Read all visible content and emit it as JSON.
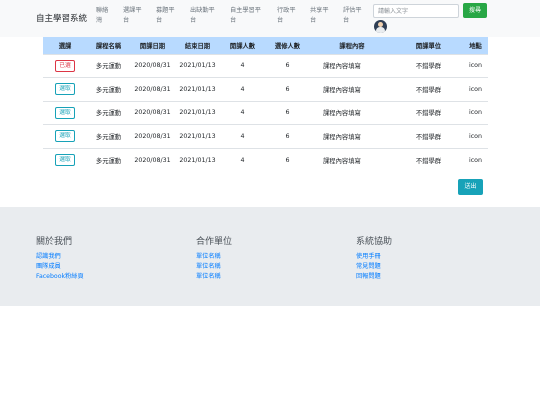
{
  "navbar": {
    "brand": "自主學習系統",
    "items": [
      {
        "line1": "聯絡",
        "line2": "灣"
      },
      {
        "line1": "選課平",
        "line2": "台"
      },
      {
        "line1": "募題平",
        "line2": "台"
      },
      {
        "line1": "出缺勤平",
        "line2": "台"
      },
      {
        "line1": "自主學習平",
        "line2": "台"
      },
      {
        "line1": "行政平",
        "line2": "台"
      },
      {
        "line1": "共享平",
        "line2": "台"
      },
      {
        "line1": "評估平",
        "line2": "台"
      }
    ],
    "search_placeholder": "請輸入文字",
    "search_button": "搜尋"
  },
  "table": {
    "headers": [
      "選課",
      "課程名稱",
      "開課日期",
      "結束日期",
      "開課人數",
      "選修人數",
      "課程內容",
      "開課單位",
      "地點"
    ],
    "rows": [
      {
        "action": "已選",
        "name": "多元運動",
        "start": "2020/08/31",
        "end": "2021/01/13",
        "capacity": "4",
        "enrolled": "6",
        "content": "課程內容填寫",
        "unit": "不錯學群",
        "place": "icon"
      },
      {
        "action": "選取",
        "name": "多元運動",
        "start": "2020/08/31",
        "end": "2021/01/13",
        "capacity": "4",
        "enrolled": "6",
        "content": "課程內容填寫",
        "unit": "不錯學群",
        "place": "icon"
      },
      {
        "action": "選取",
        "name": "多元運動",
        "start": "2020/08/31",
        "end": "2021/01/13",
        "capacity": "4",
        "enrolled": "6",
        "content": "課程內容填寫",
        "unit": "不錯學群",
        "place": "icon"
      },
      {
        "action": "選取",
        "name": "多元運動",
        "start": "2020/08/31",
        "end": "2021/01/13",
        "capacity": "4",
        "enrolled": "6",
        "content": "課程內容填寫",
        "unit": "不錯學群",
        "place": "icon"
      },
      {
        "action": "選取",
        "name": "多元運動",
        "start": "2020/08/31",
        "end": "2021/01/13",
        "capacity": "4",
        "enrolled": "6",
        "content": "課程內容填寫",
        "unit": "不錯學群",
        "place": "icon"
      }
    ]
  },
  "submit_button": "送出",
  "footer": {
    "about": {
      "title": "關於我們",
      "links": [
        "認識我們",
        "團隊成員",
        "Facebook粉絲頁"
      ]
    },
    "partners": {
      "title": "合作單位",
      "links": [
        "單位名稱",
        "單位名稱",
        "單位名稱"
      ]
    },
    "help": {
      "title": "系統協助",
      "links": [
        "使用手冊",
        "常見問題",
        "回報問題"
      ]
    }
  }
}
